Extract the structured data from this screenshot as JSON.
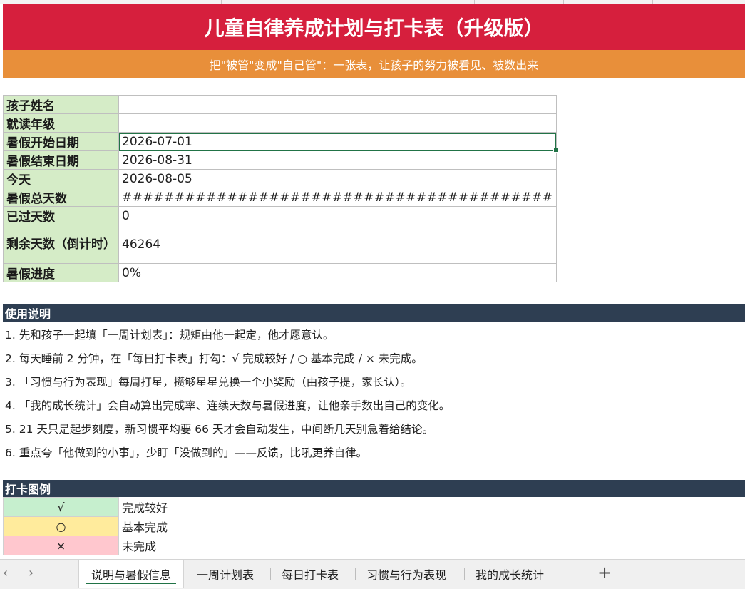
{
  "title": "儿童自律养成计划与打卡表（升级版）",
  "subtitle": "把\"被管\"变成\"自己管\"：一张表，让孩子的努力被看见、被数出来",
  "info": [
    {
      "label": "孩子姓名",
      "value": ""
    },
    {
      "label": "就读年级",
      "value": ""
    },
    {
      "label": "暑假开始日期",
      "value": "2026-07-01"
    },
    {
      "label": "暑假结束日期",
      "value": "2026-08-31"
    },
    {
      "label": "今天",
      "value": "2026-08-05"
    },
    {
      "label": "暑假总天数",
      "value": "#########################################"
    },
    {
      "label": "已过天数",
      "value": "0"
    },
    {
      "label": "剩余天数（倒计时）",
      "value": "46264"
    },
    {
      "label": "暑假进度",
      "value": "0%"
    }
  ],
  "instructions_header": "使用说明",
  "instructions": [
    "1. 先和孩子一起填「一周计划表」：规矩由他一起定，他才愿意认。",
    "2. 每天睡前 2 分钟，在「每日打卡表」打勾：√ 完成较好 / ○ 基本完成 / × 未完成。",
    "3. 「习惯与行为表现」每周打星，攒够星星兑换一个小奖励（由孩子提，家长认）。",
    "4. 「我的成长统计」会自动算出完成率、连续天数与暑假进度，让他亲手数出自己的变化。",
    "5. 21 天只是起步刻度，新习惯平均要 66 天才会自动发生，中间断几天别急着给结论。",
    "6. 重点夸「他做到的小事」，少盯「没做到的」——反馈，比吼更养自律。"
  ],
  "legend_header": "打卡图例",
  "legend": [
    {
      "symbol": "√",
      "label": "完成较好",
      "color": "#c6efce"
    },
    {
      "symbol": "○",
      "label": "基本完成",
      "color": "#ffeb9c"
    },
    {
      "symbol": "×",
      "label": "未完成",
      "color": "#ffc7ce"
    }
  ],
  "tabs": [
    "说明与暑假信息",
    "一周计划表",
    "每日打卡表",
    "习惯与行为表现",
    "我的成长统计"
  ],
  "active_tab": 0,
  "add_tab": "+",
  "nav_prev": "‹",
  "nav_next": "›",
  "colors": {
    "title_bg": "#d61f3d",
    "subtitle_bg": "#e88f3a",
    "label_bg": "#d5ecc7",
    "section_bg": "#2e3e52",
    "accent": "#217346"
  }
}
